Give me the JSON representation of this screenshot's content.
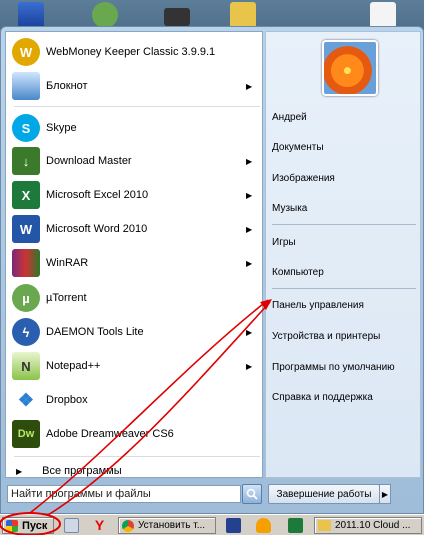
{
  "start_menu": {
    "programs": [
      {
        "label": "WebMoney Keeper Classic 3.9.9.1",
        "icon": "webmoney-icon",
        "color": "#e0a800",
        "arrow": false
      },
      {
        "label": "Блокнот",
        "icon": "notepad-icon",
        "color": "#4a88c8",
        "arrow": true
      },
      {
        "label": "Skype",
        "icon": "skype-icon",
        "color": "#00a8e8",
        "arrow": false
      },
      {
        "label": "Download Master",
        "icon": "download-master-icon",
        "color": "#3b7a2b",
        "arrow": true
      },
      {
        "label": "Microsoft Excel 2010",
        "icon": "excel-icon",
        "color": "#1e7a3a",
        "arrow": true
      },
      {
        "label": "Microsoft Word 2010",
        "icon": "word-icon",
        "color": "#2456a8",
        "arrow": true
      },
      {
        "label": "WinRAR",
        "icon": "winrar-icon",
        "color": "#7a2a7a",
        "arrow": true
      },
      {
        "label": "µTorrent",
        "icon": "utorrent-icon",
        "color": "#6aa84f",
        "arrow": false
      },
      {
        "label": "DAEMON Tools Lite",
        "icon": "daemon-tools-icon",
        "color": "#2a5fb0",
        "arrow": true
      },
      {
        "label": "Notepad++",
        "icon": "notepadpp-icon",
        "color": "#8bc34a",
        "arrow": true
      },
      {
        "label": "Dropbox",
        "icon": "dropbox-icon",
        "color": "#2a7fd4",
        "arrow": false
      },
      {
        "label": "Adobe Dreamweaver CS6",
        "icon": "dreamweaver-icon",
        "color": "#2e4d0c",
        "arrow": false
      }
    ],
    "all_programs": "Все программы",
    "search_placeholder": "Найти программы и файлы",
    "right_items": [
      {
        "label": "Андрей"
      },
      {
        "label": "Документы"
      },
      {
        "label": "Изображения"
      },
      {
        "label": "Музыка"
      },
      {
        "label": "Игры"
      },
      {
        "label": "Компьютер"
      },
      {
        "label": "Панель управления"
      },
      {
        "label": "Устройства и принтеры"
      },
      {
        "label": "Программы по умолчанию"
      },
      {
        "label": "Справка и поддержка"
      }
    ],
    "shutdown_label": "Завершение работы"
  },
  "taskbar": {
    "start_label": "Пуск",
    "buttons": [
      {
        "label": "Установить т..."
      },
      {
        "label": "2011.10 Cloud ..."
      }
    ]
  },
  "colors": {
    "annotation": "#e00000",
    "accent": "#1f5fa8"
  }
}
